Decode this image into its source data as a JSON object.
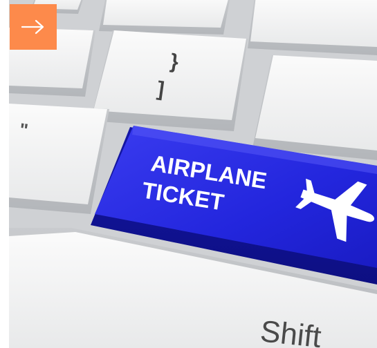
{
  "nav": {
    "icon": "arrow-right-icon",
    "color": "#fd8a4b"
  },
  "keyboard": {
    "highlight_key": {
      "line1": "AIRPLANE",
      "line2": "TICKET",
      "color": "#2a2ee8",
      "icon": "airplane-icon"
    },
    "keys": {
      "brace_upper": "}",
      "bracket_lower": "]",
      "quote": "\"",
      "shift": "Shift"
    }
  }
}
